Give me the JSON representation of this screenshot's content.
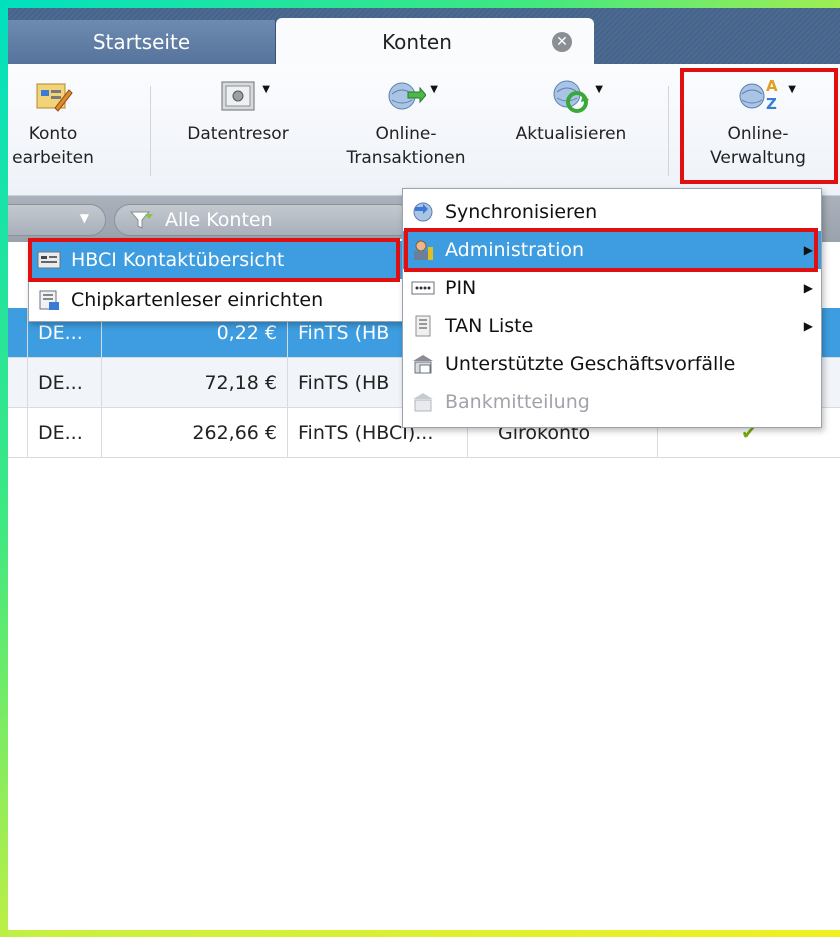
{
  "tabs": {
    "start": "Startseite",
    "active": "Konten",
    "close_glyph": "✕"
  },
  "ribbon": {
    "konto_line1": "Konto",
    "konto_line2": "earbeiten",
    "datentresor": "Datentresor",
    "online_trans_line1": "Online-",
    "online_trans_line2": "Transaktionen",
    "aktualisieren": "Aktualisieren",
    "online_verw_line1": "Online-",
    "online_verw_line2": "Verwaltung",
    "az_glyph_a": "A",
    "az_glyph_z": "Z",
    "dropdown_glyph": "▼"
  },
  "filter": {
    "label": "Alle Konten",
    "arrow": "▼"
  },
  "table": {
    "rows": [
      {
        "iban": "DE...",
        "amount": "0,22 €",
        "access": "FinTS (HB",
        "type": "",
        "check": "",
        "selected": true
      },
      {
        "iban": "DE...",
        "amount": "72,18 €",
        "access": "FinTS (HB",
        "type": "",
        "check": "",
        "selected": false
      },
      {
        "iban": "DE...",
        "amount": "262,66 €",
        "access": "FinTS (HBCI)...",
        "type": "Girokonto",
        "check": "✔",
        "selected": false
      }
    ]
  },
  "left_menu": {
    "items": [
      {
        "label": "HBCI Kontaktübersicht",
        "icon": "contact-card-icon"
      },
      {
        "label": "Chipkartenleser einrichten",
        "icon": "card-reader-icon"
      }
    ]
  },
  "right_menu": {
    "items": [
      {
        "label": "Synchronisieren",
        "icon": "sync-icon"
      },
      {
        "label": "Administration",
        "icon": "admin-user-icon",
        "submenu": "▶"
      },
      {
        "label": "PIN",
        "icon": "pin-dots-icon",
        "submenu": "▶"
      },
      {
        "label": "TAN Liste",
        "icon": "tan-list-icon",
        "submenu": "▶"
      },
      {
        "label": "Unterstützte Geschäftsvorfälle",
        "icon": "transactions-icon"
      },
      {
        "label": "Bankmitteilung",
        "icon": "bank-message-icon"
      }
    ]
  },
  "colors": {
    "highlight_red": "#e01010",
    "selection_blue": "#3d9de0"
  }
}
